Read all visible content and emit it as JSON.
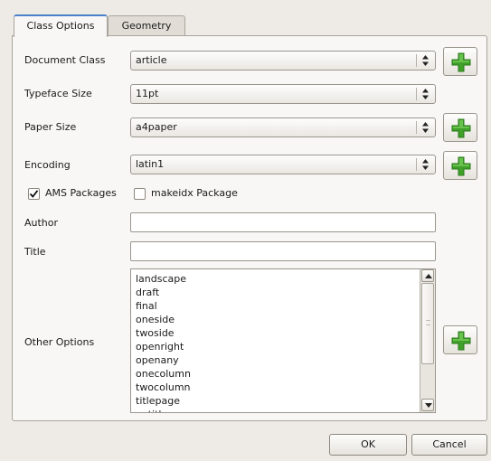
{
  "tabs": [
    {
      "label": "Class Options",
      "active": true
    },
    {
      "label": "Geometry",
      "active": false
    }
  ],
  "fields": {
    "document_class": {
      "label": "Document Class",
      "value": "article"
    },
    "typeface_size": {
      "label": "Typeface Size",
      "value": "11pt"
    },
    "paper_size": {
      "label": "Paper Size",
      "value": "a4paper"
    },
    "encoding": {
      "label": "Encoding",
      "value": "latin1"
    }
  },
  "checkboxes": {
    "ams_packages": {
      "label": "AMS Packages",
      "checked": true
    },
    "makeidx_package": {
      "label": "makeidx Package",
      "checked": false
    }
  },
  "author": {
    "label": "Author",
    "value": ""
  },
  "title": {
    "label": "Title",
    "value": ""
  },
  "other_options": {
    "label": "Other Options",
    "items": [
      "landscape",
      "draft",
      "final",
      "oneside",
      "twoside",
      "openright",
      "openany",
      "onecolumn",
      "twocolumn",
      "titlepage",
      "notitlepage"
    ]
  },
  "footer": {
    "ok": "OK",
    "cancel": "Cancel"
  },
  "colors": {
    "accent": "#4a82c9",
    "plus_green": "#3fa02a"
  },
  "icons": {
    "add": "plus-icon",
    "combo": "updown-arrows-icon",
    "check": "checkmark-icon"
  }
}
